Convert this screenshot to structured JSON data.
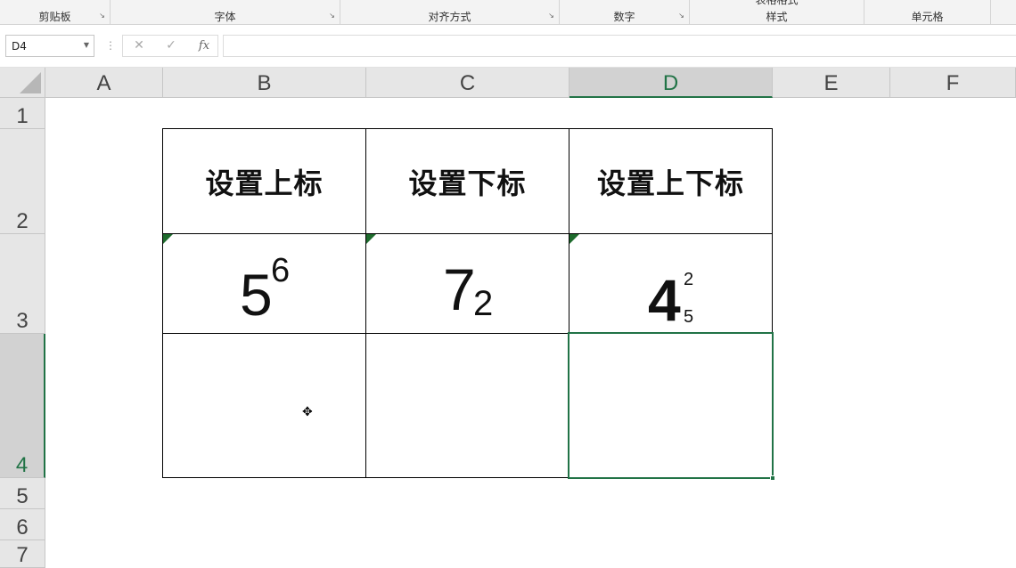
{
  "ribbon": {
    "groups": [
      {
        "label": "剪贴板",
        "launcher": "↘"
      },
      {
        "label": "字体",
        "launcher": "↘"
      },
      {
        "label": "对齐方式",
        "launcher": "↘"
      },
      {
        "label": "数字",
        "launcher": "↘"
      },
      {
        "label": "样式",
        "clipped_text": "表格格式"
      },
      {
        "label": "单元格"
      }
    ]
  },
  "formula_bar": {
    "name_box": "D4",
    "cancel_glyph": "✕",
    "enter_glyph": "✓",
    "fx_label": "fx",
    "formula": ""
  },
  "columns": [
    "A",
    "B",
    "C",
    "D",
    "E",
    "F"
  ],
  "rows": [
    "1",
    "2",
    "3",
    "4",
    "5",
    "6",
    "7"
  ],
  "selected_cell": "D4",
  "table": {
    "headers": [
      "设置上标",
      "设置下标",
      "设置上下标"
    ],
    "row3": {
      "b": {
        "base": "5",
        "superscript": "6"
      },
      "c": {
        "base": "7",
        "subscript": "2"
      },
      "d": {
        "base": "4",
        "superscript": "2",
        "subscript": "5"
      }
    }
  },
  "colors": {
    "accent": "#217346",
    "error_indicator": "#1e6b2d",
    "header_bg": "#e6e6e6"
  },
  "icons": {
    "name_box_dropdown": "chevron-down-icon",
    "cancel": "close-icon",
    "enter": "check-icon",
    "cursor": "cross-cursor-icon"
  }
}
